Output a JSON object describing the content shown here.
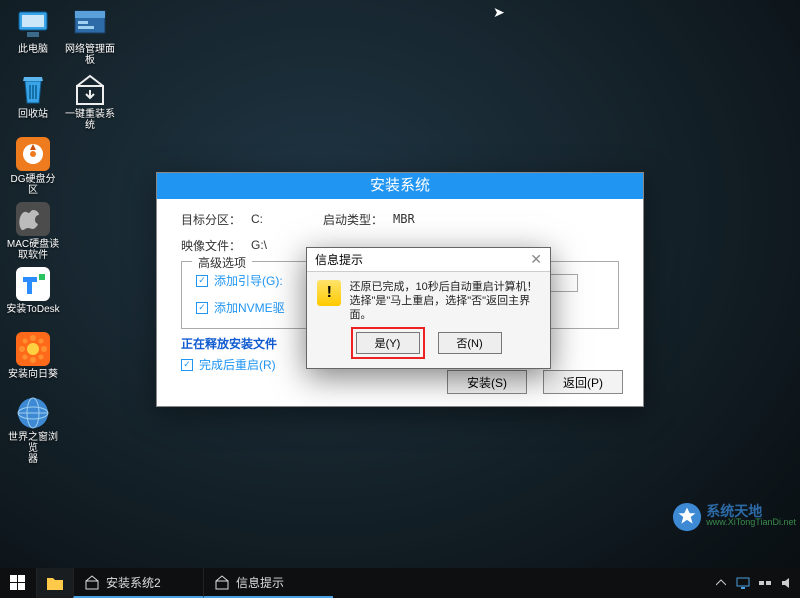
{
  "desktop": {
    "col1": [
      {
        "label": "此电脑",
        "icon": "pc"
      },
      {
        "label": "回收站",
        "icon": "recycle"
      },
      {
        "label": "DG硬盘分区",
        "icon": "dg"
      },
      {
        "label": "MAC硬盘读\n取软件",
        "icon": "mac"
      },
      {
        "label": "安装ToDesk",
        "icon": "todesk"
      },
      {
        "label": "安装向日葵",
        "icon": "sunflower"
      },
      {
        "label": "世界之窗浏览\n器",
        "icon": "globe"
      }
    ],
    "col2": [
      {
        "label": "网络管理面板",
        "icon": "netpanel"
      },
      {
        "label": "一键重装系统",
        "icon": "reinstall"
      }
    ]
  },
  "install": {
    "title": "安装系统",
    "target_label": "目标分区：",
    "target_value": "C:",
    "boot_label": "启动类型：",
    "boot_value": "MBR",
    "image_label": "映像文件：",
    "image_value": "G:\\",
    "advanced_label": "高级选项",
    "add_boot_label": "添加引导(G):",
    "add_nvme_label": "添加NVME驱",
    "status": "正在释放安装文件",
    "restart_label": "完成后重启(R)",
    "install_btn": "安装(S)",
    "back_btn": "返回(P)"
  },
  "dialog": {
    "title": "信息提示",
    "line1": "还原已完成，10秒后自动重启计算机！",
    "line2": "选择\"是\"马上重启，选择\"否\"返回主界面。",
    "yes": "是(Y)",
    "no": "否(N)",
    "close": "✕"
  },
  "taskbar": {
    "items": [
      {
        "label": "安装系统2",
        "icon": "reinstall"
      },
      {
        "label": "信息提示",
        "icon": "reinstall"
      }
    ]
  },
  "watermark": {
    "brand_top": "系统天地",
    "brand_url": "www.XiTongTianDi.net"
  }
}
